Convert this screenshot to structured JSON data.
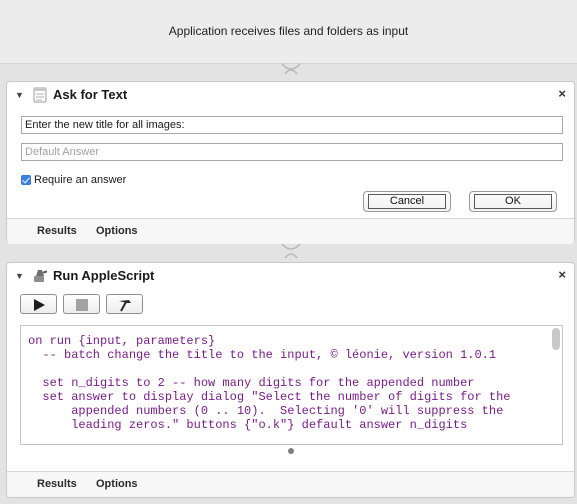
{
  "workflow": {
    "input_description": "Application receives files and folders as input"
  },
  "ask_for_text": {
    "title": "Ask for Text",
    "question_value": "Enter the new title for all images:",
    "default_answer_placeholder": "Default Answer",
    "require_answer_label": "Require an answer",
    "require_answer_checked": true,
    "cancel_label": "Cancel",
    "ok_label": "OK",
    "footer": {
      "results_label": "Results",
      "options_label": "Options"
    }
  },
  "run_applescript": {
    "title": "Run AppleScript",
    "code_lines": [
      "on run {input, parameters}",
      "  -- batch change the title to the input, © léonie, version 1.0.1",
      "",
      "  set n_digits to 2 -- how many digits for the appended number",
      "  set answer to display dialog \"Select the number of digits for the",
      "      appended numbers (0 .. 10).  Selecting '0' will suppress the",
      "      leading zeros.\" buttons {\"o.k\"} default answer n_digits"
    ],
    "footer": {
      "results_label": "Results",
      "options_label": "Options"
    }
  },
  "icons": {
    "close": "close-icon",
    "disclosure": "disclosure-triangle-icon",
    "run": "play-icon",
    "stop": "stop-icon",
    "compile": "hammer-icon"
  },
  "colors": {
    "code_text": "#7a1c8c",
    "checkbox": "#3b82e4"
  }
}
